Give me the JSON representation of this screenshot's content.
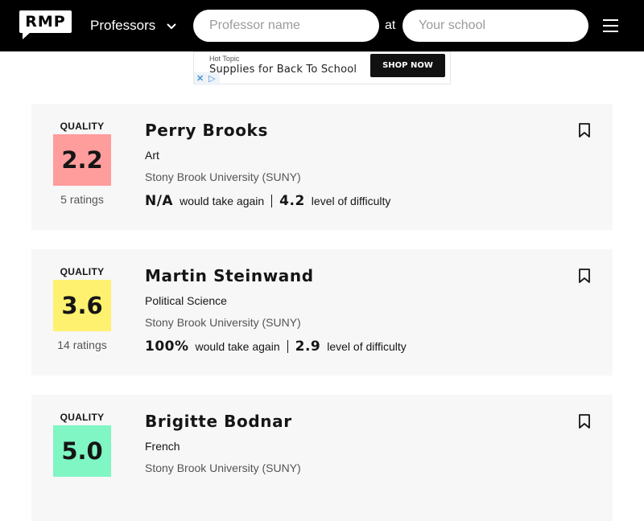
{
  "header": {
    "logo_text": "RMP",
    "search_type_label": "Professors",
    "professor_placeholder": "Professor name",
    "at_label": "at",
    "school_placeholder": "Your school"
  },
  "ad": {
    "brand": "Hot Topic",
    "headline": "Supplies for Back To School",
    "cta": "SHOP NOW"
  },
  "quality_label": "QUALITY",
  "professors": [
    {
      "name": "Perry Brooks",
      "department": "Art",
      "school": "Stony Brook University (SUNY)",
      "quality": "2.2",
      "quality_color": "#ff9c9c",
      "ratings": "5 ratings",
      "would_take_again": "N/A",
      "would_take_again_label": "would take again",
      "difficulty": "4.2",
      "difficulty_label": "level of difficulty"
    },
    {
      "name": "Martin Steinwand",
      "department": "Political Science",
      "school": "Stony Brook University (SUNY)",
      "quality": "3.6",
      "quality_color": "#fff170",
      "ratings": "14 ratings",
      "would_take_again": "100%",
      "would_take_again_label": "would take again",
      "difficulty": "2.9",
      "difficulty_label": "level of difficulty"
    },
    {
      "name": "Brigitte Bodnar",
      "department": "French",
      "school": "Stony Brook University (SUNY)",
      "quality": "5.0",
      "quality_color": "#7ff6c3"
    }
  ]
}
